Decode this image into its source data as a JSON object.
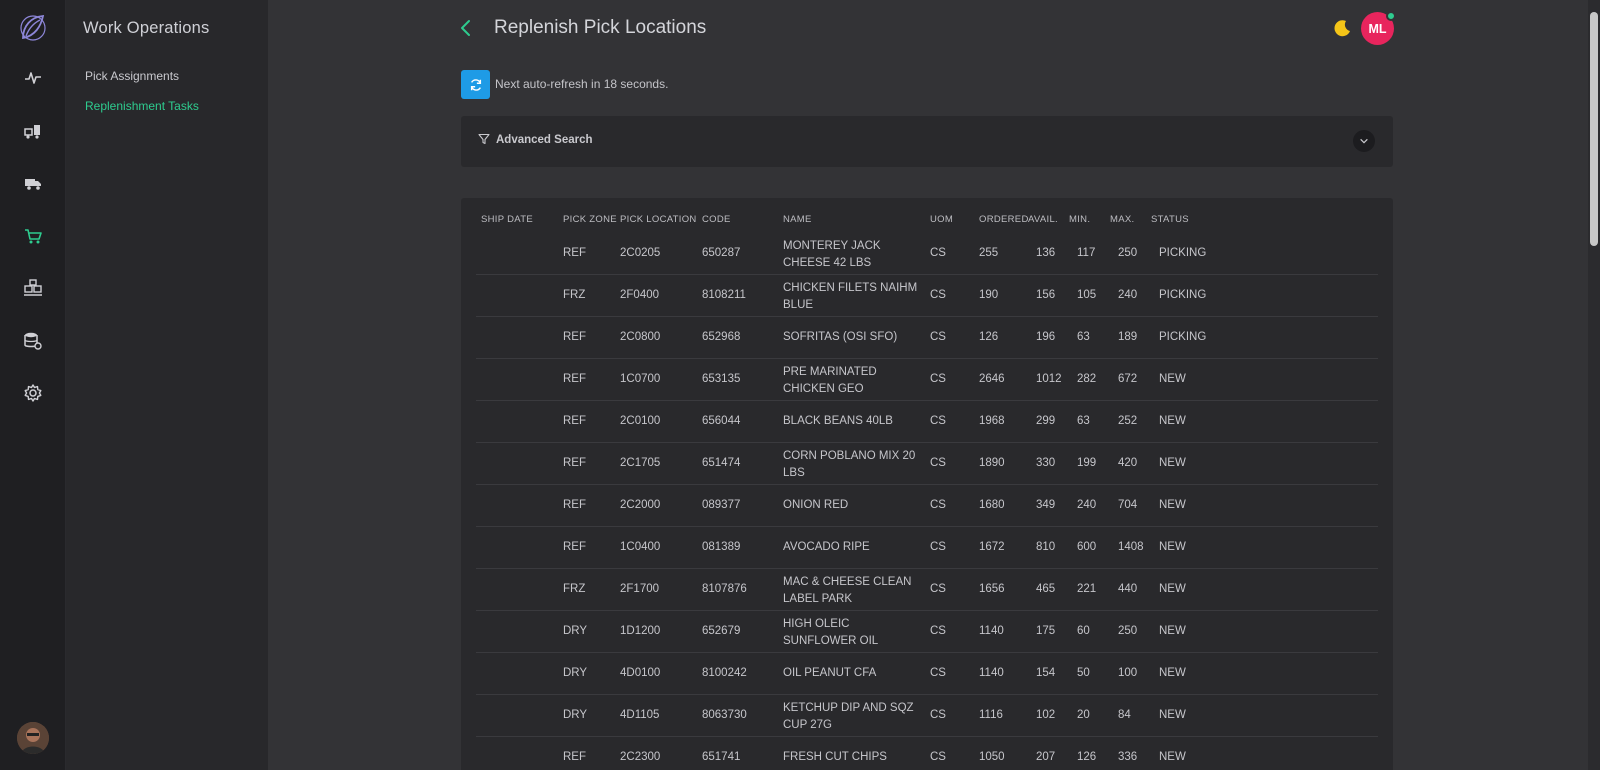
{
  "sidebar": {
    "title": "Work Operations",
    "items": [
      {
        "label": "Pick Assignments",
        "active": false
      },
      {
        "label": "Replenishment Tasks",
        "active": true
      }
    ]
  },
  "rail": {
    "icons": [
      "logo-icon",
      "activity-icon",
      "forklift-icon",
      "truck-icon",
      "cart-icon",
      "pallet-icon",
      "database-settings-icon",
      "gear-icon"
    ],
    "active": "cart-icon"
  },
  "header": {
    "title": "Replenish Pick Locations",
    "avatar_initials": "ML"
  },
  "refresh": {
    "text": "Next auto-refresh in 18 seconds."
  },
  "search": {
    "label": "Advanced Search"
  },
  "table": {
    "columns": [
      "SHIP DATE",
      "PICK ZONE",
      "PICK LOCATION",
      "CODE",
      "NAME",
      "UOM",
      "ORDERED",
      "AVAIL.",
      "MIN.",
      "MAX.",
      "STATUS"
    ],
    "rows": [
      {
        "ship_date": "",
        "zone": "REF",
        "location": "2C0205",
        "code": "650287",
        "name": "MONTEREY JACK CHEESE 42 LBS",
        "uom": "CS",
        "ordered": "255",
        "avail": "136",
        "min": "117",
        "max": "250",
        "status": "PICKING"
      },
      {
        "ship_date": "",
        "zone": "FRZ",
        "location": "2F0400",
        "code": "8108211",
        "name": "CHICKEN FILETS NAIHM BLUE",
        "uom": "CS",
        "ordered": "190",
        "avail": "156",
        "min": "105",
        "max": "240",
        "status": "PICKING"
      },
      {
        "ship_date": "",
        "zone": "REF",
        "location": "2C0800",
        "code": "652968",
        "name": "SOFRITAS (OSI SFO)",
        "uom": "CS",
        "ordered": "126",
        "avail": "196",
        "min": "63",
        "max": "189",
        "status": "PICKING"
      },
      {
        "ship_date": "",
        "zone": "REF",
        "location": "1C0700",
        "code": "653135",
        "name": "PRE MARINATED CHICKEN GEO",
        "uom": "CS",
        "ordered": "2646",
        "avail": "1012",
        "min": "282",
        "max": "672",
        "status": "NEW"
      },
      {
        "ship_date": "",
        "zone": "REF",
        "location": "2C0100",
        "code": "656044",
        "name": "BLACK BEANS 40LB",
        "uom": "CS",
        "ordered": "1968",
        "avail": "299",
        "min": "63",
        "max": "252",
        "status": "NEW"
      },
      {
        "ship_date": "",
        "zone": "REF",
        "location": "2C1705",
        "code": "651474",
        "name": "CORN POBLANO MIX 20 LBS",
        "uom": "CS",
        "ordered": "1890",
        "avail": "330",
        "min": "199",
        "max": "420",
        "status": "NEW"
      },
      {
        "ship_date": "",
        "zone": "REF",
        "location": "2C2000",
        "code": "089377",
        "name": "ONION RED",
        "uom": "CS",
        "ordered": "1680",
        "avail": "349",
        "min": "240",
        "max": "704",
        "status": "NEW"
      },
      {
        "ship_date": "",
        "zone": "REF",
        "location": "1C0400",
        "code": "081389",
        "name": "AVOCADO RIPE",
        "uom": "CS",
        "ordered": "1672",
        "avail": "810",
        "min": "600",
        "max": "1408",
        "status": "NEW"
      },
      {
        "ship_date": "",
        "zone": "FRZ",
        "location": "2F1700",
        "code": "8107876",
        "name": "MAC & CHEESE CLEAN LABEL PARK",
        "uom": "CS",
        "ordered": "1656",
        "avail": "465",
        "min": "221",
        "max": "440",
        "status": "NEW"
      },
      {
        "ship_date": "",
        "zone": "DRY",
        "location": "1D1200",
        "code": "652679",
        "name": "HIGH OLEIC SUNFLOWER OIL",
        "uom": "CS",
        "ordered": "1140",
        "avail": "175",
        "min": "60",
        "max": "250",
        "status": "NEW"
      },
      {
        "ship_date": "",
        "zone": "DRY",
        "location": "4D0100",
        "code": "8100242",
        "name": "OIL PEANUT CFA",
        "uom": "CS",
        "ordered": "1140",
        "avail": "154",
        "min": "50",
        "max": "100",
        "status": "NEW"
      },
      {
        "ship_date": "",
        "zone": "DRY",
        "location": "4D1105",
        "code": "8063730",
        "name": "KETCHUP DIP AND SQZ CUP 27G",
        "uom": "CS",
        "ordered": "1116",
        "avail": "102",
        "min": "20",
        "max": "84",
        "status": "NEW"
      },
      {
        "ship_date": "",
        "zone": "REF",
        "location": "2C2300",
        "code": "651741",
        "name": "FRESH CUT CHIPS",
        "uom": "CS",
        "ordered": "1050",
        "avail": "207",
        "min": "126",
        "max": "336",
        "status": "NEW"
      }
    ]
  },
  "colors": {
    "accent_green": "#2ecc8f",
    "refresh_blue": "#1e9be6",
    "avatar_pink": "#e8255d",
    "moon_yellow": "#f5c518"
  }
}
